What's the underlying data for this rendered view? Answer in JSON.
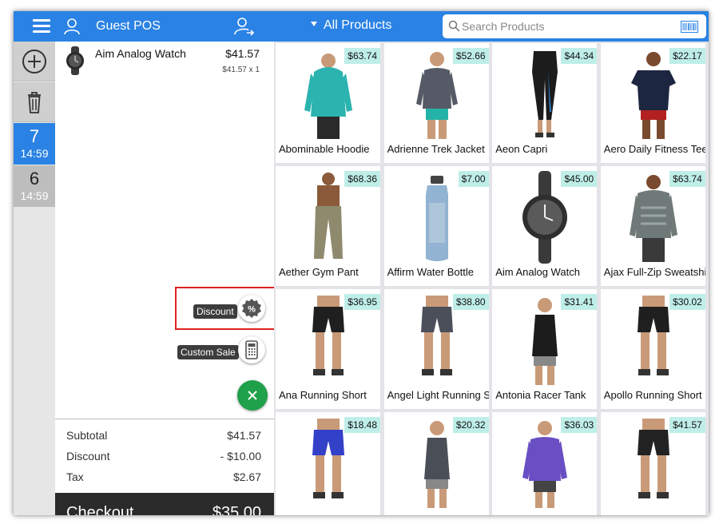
{
  "header": {
    "store_name": "Guest POS",
    "category": "All Products",
    "search_placeholder": "Search Products"
  },
  "rail": {
    "orders": [
      {
        "number": "7",
        "time": "14:59",
        "active": true
      },
      {
        "number": "6",
        "time": "14:59",
        "active": false
      }
    ]
  },
  "cart": {
    "items": [
      {
        "name": "Aim Analog Watch",
        "price": "$41.57",
        "qty_line": "$41.57 x 1"
      }
    ],
    "actions": {
      "discount_label": "Discount",
      "custom_sale_label": "Custom Sale"
    },
    "totals": {
      "subtotal_label": "Subtotal",
      "subtotal": "$41.57",
      "discount_label": "Discount",
      "discount": "- $10.00",
      "tax_label": "Tax",
      "tax": "$2.67"
    },
    "checkout_label": "Checkout",
    "checkout_total": "$35.00"
  },
  "products": [
    {
      "name": "Abominable Hoodie",
      "price": "$63.74",
      "icon": "hoodie-icon",
      "color": "#2bb3b0"
    },
    {
      "name": "Adrienne Trek Jacket",
      "price": "$52.66",
      "icon": "jacket-icon",
      "color": "#555a66"
    },
    {
      "name": "Aeon Capri",
      "price": "$44.34",
      "icon": "capri-icon",
      "color": "#1c1c1c"
    },
    {
      "name": "Aero Daily Fitness Tee",
      "price": "$22.17",
      "icon": "tee-icon",
      "color": "#1d2640"
    },
    {
      "name": "Aether Gym Pant",
      "price": "$68.36",
      "icon": "pant-icon",
      "color": "#8f8a6e"
    },
    {
      "name": "Affirm Water Bottle",
      "price": "$7.00",
      "icon": "bottle-icon",
      "color": "#7fa6c9"
    },
    {
      "name": "Aim Analog Watch",
      "price": "$45.00",
      "icon": "watch-icon",
      "color": "#2e2e2e"
    },
    {
      "name": "Ajax Full-Zip Sweatshirt",
      "price": "$63.74",
      "icon": "sweatshirt-icon",
      "color": "#6f7a78"
    },
    {
      "name": "Ana Running Short",
      "price": "$36.95",
      "icon": "short-icon",
      "color": "#1f1f1f"
    },
    {
      "name": "Angel Light Running Short",
      "price": "$38.80",
      "icon": "short-icon",
      "color": "#4a4f5a"
    },
    {
      "name": "Antonia Racer Tank",
      "price": "$31.41",
      "icon": "tank-icon",
      "color": "#1c1c1c"
    },
    {
      "name": "Apollo Running Short",
      "price": "$30.02",
      "icon": "short-icon",
      "color": "#1f1f1f"
    },
    {
      "name": "",
      "price": "$18.48",
      "icon": "short-icon",
      "color": "#3340c8"
    },
    {
      "name": "",
      "price": "$20.32",
      "icon": "tank-icon",
      "color": "#4a4f57"
    },
    {
      "name": "",
      "price": "$36.03",
      "icon": "top-icon",
      "color": "#6a4fc4"
    },
    {
      "name": "",
      "price": "$41.57",
      "icon": "short-icon",
      "color": "#222222"
    }
  ],
  "colors": {
    "accent": "#2a82e4",
    "price_tag": "#bfeee8",
    "fab": "#1fa04a",
    "highlight": "#e02020"
  }
}
